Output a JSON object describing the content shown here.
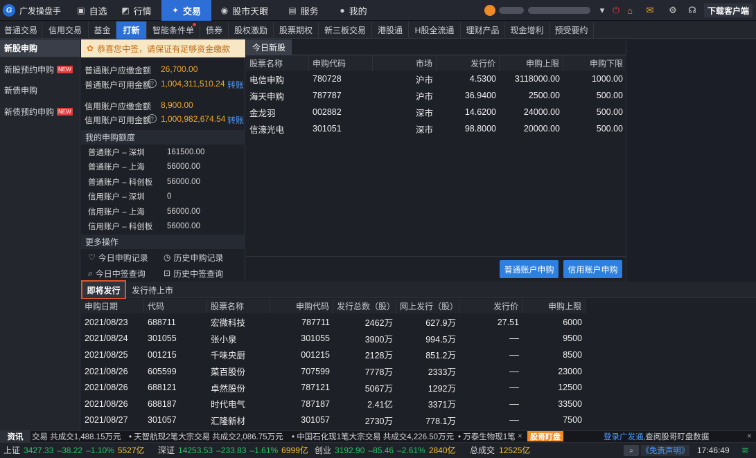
{
  "app": {
    "title": "广发操盘手",
    "download_label": "下载客户端"
  },
  "main_nav": [
    {
      "label": "自选",
      "icon": "square-icon"
    },
    {
      "label": "行情",
      "icon": "chart-icon"
    },
    {
      "label": "交易",
      "icon": "lightning-icon",
      "active": true
    },
    {
      "label": "股市天眼",
      "icon": "eye-icon"
    },
    {
      "label": "服务",
      "icon": "briefcase-icon"
    },
    {
      "label": "我的",
      "icon": "person-icon"
    }
  ],
  "sub_nav": [
    "普通交易",
    "信用交易",
    "基金",
    "打新",
    "智能条件单",
    "债券",
    "股权激励",
    "股票期权",
    "新三板交易",
    "港股通",
    "H股全流通",
    "理财产品",
    "现金增利",
    "预受要约"
  ],
  "sub_nav_active": "打新",
  "sidebar": [
    {
      "label": "新股申购",
      "active": true,
      "badge": ""
    },
    {
      "label": "新股预约申购",
      "badge": "NEW"
    },
    {
      "label": "新债申购",
      "badge": ""
    },
    {
      "label": "新债预约申购",
      "badge": "NEW"
    }
  ],
  "notice": "恭喜您中签，请保证有足够资金缴款",
  "accounts": {
    "normal_due_label": "普通账户应缴金额",
    "normal_due": "26,700.00",
    "normal_avail_label": "普通账户可用金额",
    "normal_avail": "1,004,311,510.24",
    "credit_due_label": "信用账户应缴金额",
    "credit_due": "8,900.00",
    "credit_avail_label": "信用账户可用金额",
    "credit_avail": "1,000,982,674.54",
    "transfer_label": "转账",
    "help_glyph": "?"
  },
  "quota": {
    "title": "我的申购额度",
    "rows": [
      {
        "label": "普通账户 – 深圳",
        "value": "161500.00"
      },
      {
        "label": "普通账户 – 上海",
        "value": "56000.00"
      },
      {
        "label": "普通账户 – 科创板",
        "value": "56000.00"
      },
      {
        "label": "信用账户 – 深圳",
        "value": "0"
      },
      {
        "label": "信用账户 – 上海",
        "value": "56000.00"
      },
      {
        "label": "信用账户 – 科创板",
        "value": "56000.00"
      }
    ]
  },
  "more_ops": {
    "title": "更多操作",
    "items": [
      "今日申购记录",
      "历史申购记录",
      "今日中签查询",
      "历史中签查询"
    ]
  },
  "today": {
    "tab": "今日新股",
    "columns": [
      "股票名称",
      "申购代码",
      "市场",
      "发行价",
      "申购上限",
      "申购下限"
    ],
    "rows": [
      [
        "电信申购",
        "780728",
        "沪市",
        "4.5300",
        "3118000.00",
        "1000.00"
      ],
      [
        "海天申购",
        "787787",
        "沪市",
        "36.9400",
        "2500.00",
        "500.00"
      ],
      [
        "金龙羽",
        "002882",
        "深市",
        "14.6200",
        "24000.00",
        "500.00"
      ],
      [
        "信濠光电",
        "301051",
        "深市",
        "98.8000",
        "20000.00",
        "500.00"
      ]
    ],
    "btn_normal": "普通账户申购",
    "btn_credit": "信用账户申购"
  },
  "upcoming": {
    "tabs": [
      "即将发行",
      "发行待上市"
    ],
    "columns": [
      "申购日期",
      "代码",
      "股票名称",
      "申购代码",
      "发行总数（股）",
      "网上发行（股）",
      "发行价",
      "申购上限"
    ],
    "rows": [
      [
        "2021/08/23",
        "688711",
        "宏微科技",
        "787711",
        "2462万",
        "627.9万",
        "27.51",
        "6000"
      ],
      [
        "2021/08/24",
        "301055",
        "张小泉",
        "301055",
        "3900万",
        "994.5万",
        "––",
        "9500"
      ],
      [
        "2021/08/25",
        "001215",
        "千味央厨",
        "001215",
        "2128万",
        "851.2万",
        "––",
        "8500"
      ],
      [
        "2021/08/26",
        "605599",
        "菜百股份",
        "707599",
        "7778万",
        "2333万",
        "––",
        "23000"
      ],
      [
        "2021/08/26",
        "688121",
        "卓然股份",
        "787121",
        "5067万",
        "1292万",
        "––",
        "12500"
      ],
      [
        "2021/08/26",
        "688187",
        "时代电气",
        "787187",
        "2.41亿",
        "3371万",
        "––",
        "33500"
      ],
      [
        "2021/08/27",
        "301057",
        "汇隆新材",
        "301057",
        "2730万",
        "778.1万",
        "––",
        "7500"
      ]
    ]
  },
  "ticker": {
    "label": "资讯",
    "items": [
      "交易 共成交1,488.15万元",
      "• 天智航现2笔大宗交易 共成交2,086.75万元",
      "• 中国石化现1笔大宗交易 共成交4,226.50万元",
      "• 万泰生物现1笔"
    ],
    "close_glyph": "×",
    "badge": "股哥盯盘",
    "promo_link": "登录广发通",
    "promo_text": ",查阅股哥盯盘数据"
  },
  "status": {
    "sh": {
      "name": "上证",
      "value": "3427.33",
      "chg": "–38.22",
      "pct": "–1.10%",
      "amt": "5527亿"
    },
    "sz": {
      "name": "深证",
      "value": "14253.53",
      "chg": "–233.83",
      "pct": "–1.61%",
      "amt": "6999亿"
    },
    "cy": {
      "name": "创业",
      "value": "3192.90",
      "chg": "–85.46",
      "pct": "–2.61%",
      "amt": "2840亿"
    },
    "total_label": "总成交",
    "total": "12525亿",
    "disclaimer": "《免责声明》",
    "time": "17:46:49"
  },
  "colors": {
    "accent": "#2d6fd7",
    "orange": "#f0a82b",
    "green": "#27c46a",
    "link": "#4a9aff"
  }
}
